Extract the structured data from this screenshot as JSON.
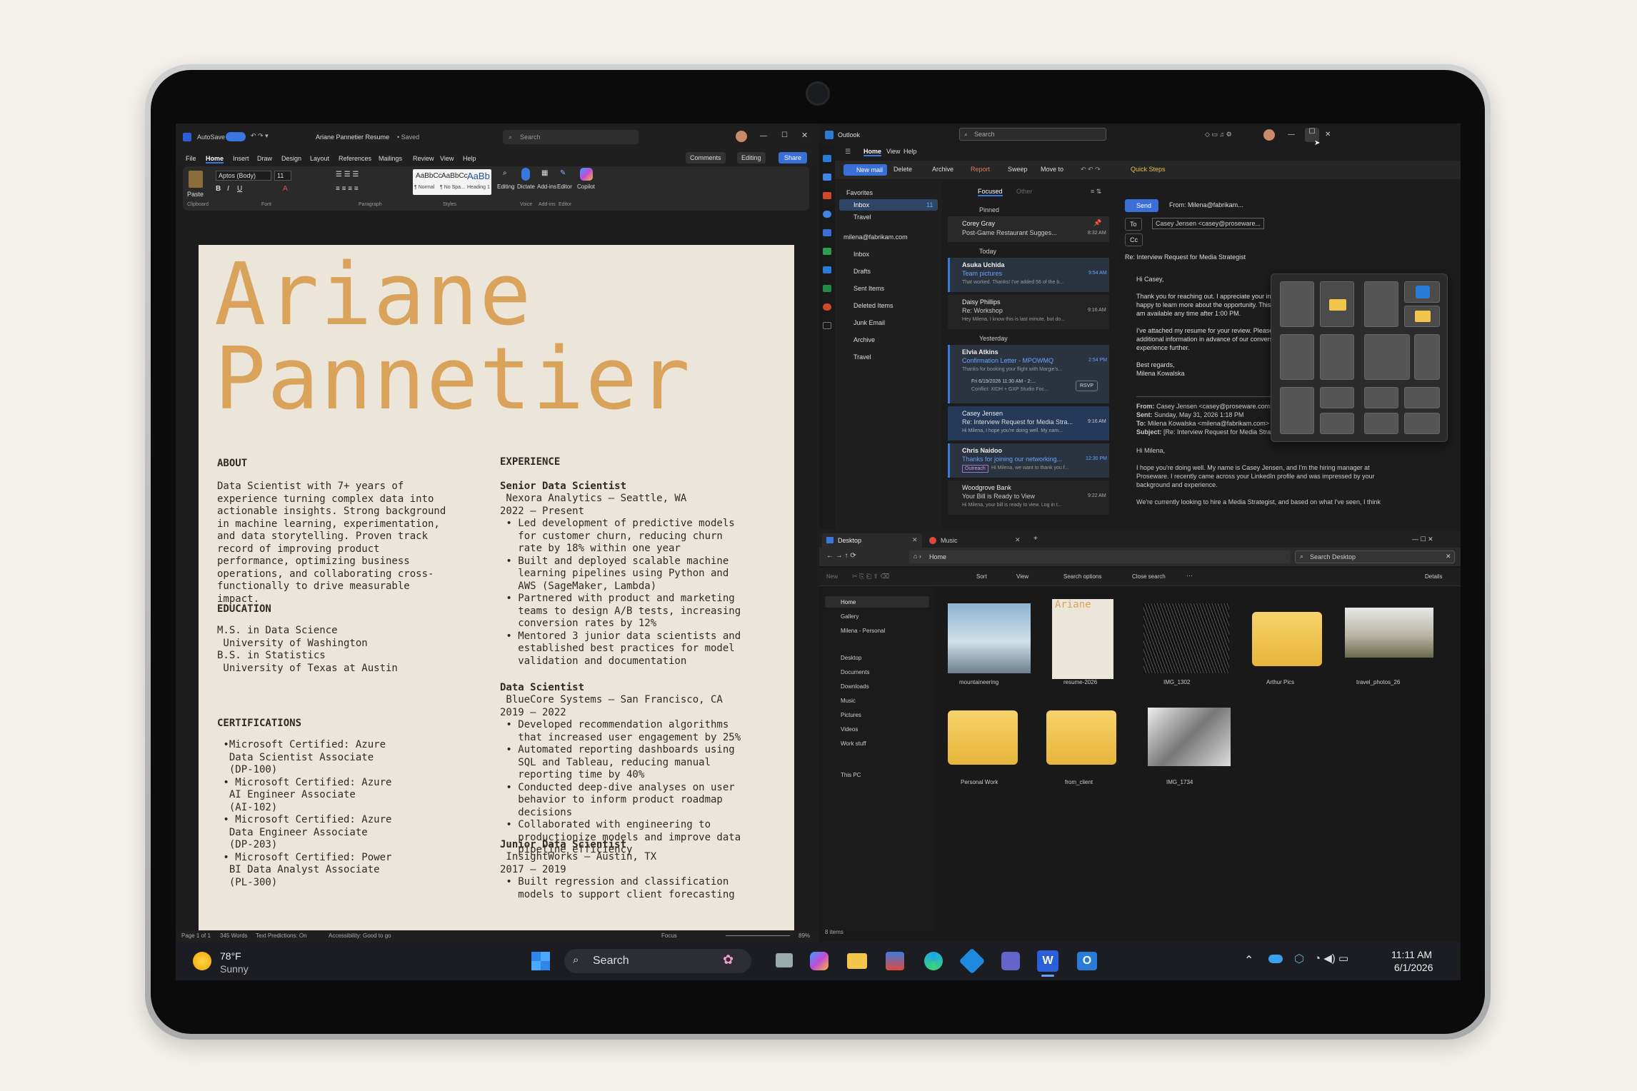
{
  "word": {
    "autosave": "AutoSave",
    "doc_title": "Ariane Pannetier Resume",
    "saved": "• Saved",
    "search": "Search",
    "tabs": [
      "File",
      "Home",
      "Insert",
      "Draw",
      "Design",
      "Layout",
      "References",
      "Mailings",
      "Review",
      "View",
      "Help"
    ],
    "comments": "Comments",
    "editing": "Editing",
    "share": "Share",
    "font": "Aptos (Body)",
    "size": "11",
    "styles": [
      {
        "sample": "AaBbCc",
        "name": "¶ Normal"
      },
      {
        "sample": "AaBbCc",
        "name": "¶ No Spa..."
      },
      {
        "sample": "AaBb",
        "name": "Heading 1"
      }
    ],
    "ribbon_groups": [
      "Clipboard",
      "Font",
      "Paragraph",
      "Styles",
      "Voice",
      "Add-ins",
      "Editor"
    ],
    "ribbon_buttons": [
      "Paste",
      "Editing",
      "Dictate",
      "Add-ins",
      "Editor",
      "Copilot"
    ],
    "status": [
      "Page 1 of 1",
      "345 Words",
      "Text Predictions: On",
      "Accessibility: Good to go",
      "Focus",
      "89%"
    ]
  },
  "resume": {
    "first": "Ariane",
    "last": "Pannetier",
    "about_h": "ABOUT",
    "about": "Data Scientist with 7+ years of\nexperience turning complex data into\nactionable insights. Strong background\nin machine learning, experimentation,\nand data storytelling. Proven track\nrecord of improving product\nperformance, optimizing business\noperations, and collaborating cross-\nfunctionally to drive measurable\nimpact.",
    "edu_h": "EDUCATION",
    "edu": "M.S. in Data Science\n University of Washington\nB.S. in Statistics\n University of Texas at Austin",
    "cert_h": "CERTIFICATIONS",
    "cert": " •Microsoft Certified: Azure\n  Data Scientist Associate\n  (DP-100)\n • Microsoft Certified: Azure\n  AI Engineer Associate\n  (AI-102)\n • Microsoft Certified: Azure\n  Data Engineer Associate\n  (DP-203)\n • Microsoft Certified: Power\n  BI Data Analyst Associate\n  (PL-300)",
    "exp_h": "EXPERIENCE",
    "jobs": [
      {
        "title": "Senior Data Scientist",
        "meta": " Nexora Analytics — Seattle, WA\n2022 – Present",
        "bullets": " • Led development of predictive models\n   for customer churn, reducing churn\n   rate by 18% within one year\n • Built and deployed scalable machine\n   learning pipelines using Python and\n   AWS (SageMaker, Lambda)\n • Partnered with product and marketing\n   teams to design A/B tests, increasing\n   conversion rates by 12%\n • Mentored 3 junior data scientists and\n   established best practices for model\n   validation and documentation"
      },
      {
        "title": "Data Scientist",
        "meta": " BlueCore Systems — San Francisco, CA\n2019 – 2022",
        "bullets": " • Developed recommendation algorithms\n   that increased user engagement by 25%\n • Automated reporting dashboards using\n   SQL and Tableau, reducing manual\n   reporting time by 40%\n • Conducted deep-dive analyses on user\n   behavior to inform product roadmap\n   decisions\n • Collaborated with engineering to\n   productionize models and improve data\n   pipeline efficiency"
      },
      {
        "title": "Junior Data Scientist",
        "meta": " InsightWorks — Austin, TX\n2017 – 2019",
        "bullets": " • Built regression and classification\n   models to support client forecasting"
      }
    ]
  },
  "outlook": {
    "app": "Outlook",
    "search": "Search",
    "tabs": [
      "Home",
      "View",
      "Help"
    ],
    "toolbar": [
      "New mail",
      "Delete",
      "Archive",
      "Report",
      "Sweep",
      "Move to",
      "Quick Steps"
    ],
    "favorites": "Favorites",
    "fav_items": [
      {
        "label": "Inbox",
        "count": "11"
      },
      {
        "label": "Travel",
        "count": ""
      }
    ],
    "account": "milena@fabrikam.com",
    "folders": [
      "Inbox",
      "Drafts",
      "Sent Items",
      "Deleted Items",
      "Junk Email",
      "Archive",
      "Travel"
    ],
    "list_tabs": [
      "Focused",
      "Other"
    ],
    "groups": [
      "Pinned",
      "Today",
      "Yesterday"
    ],
    "mails": [
      {
        "from": "Corey Gray",
        "subject": "Post-Game Restaurant Sugges...",
        "time": "8:32 AM",
        "preview": ""
      },
      {
        "from": "Asuka Uchida",
        "subject": "Team pictures",
        "time": "9:54 AM",
        "preview": "That worked. Thanks! I've added 56 of the b..."
      },
      {
        "from": "Daisy Phillips",
        "subject": "Re: Workshop",
        "time": "9:16 AM",
        "preview": "Hey Milena, I know this is last minute, but do..."
      },
      {
        "from": "Elvia Atkins",
        "subject": "Confirmation Letter - MPOWMQ",
        "time": "2:54 PM",
        "preview": "Thanks for booking your flight with Margie's...",
        "event": "Fri 6/19/2026 11:30 AM - 2:...",
        "conflict": "Conflict: XIDH + GXP Studio Foc...",
        "rsvp": "RSVP"
      },
      {
        "from": "Casey Jensen",
        "subject": "Re: Interview Request for Media Stra...",
        "time": "9:16 AM",
        "preview": "Hi Milena, I hope you're doing well. My nam..."
      },
      {
        "from": "Chris Naidoo",
        "subject": "Thanks for joining our networking...",
        "time": "12:30 PM",
        "preview": "Hi Milena, we want to thank you f...",
        "tag": "Outreach"
      },
      {
        "from": "Woodgrove Bank",
        "subject": "Your Bill is Ready to View",
        "time": "9:22 AM",
        "preview": "Hi Milena, your bill is ready to view. Log in t..."
      }
    ],
    "send": "Send",
    "from": "From: Milena@fabrikam...",
    "to_label": "To",
    "to": "Casey Jensen <casey@proseware...",
    "cc": "Cc",
    "subject": "Re: Interview Request for Media Strategist",
    "body": "Hi Casey,\n\nThank you for reaching out. I appreciate your interest in my background and would be\nhappy to learn more about the opportunity. This Wednesday works well for me, and I\nam available any time after 1:00 PM.\n\nI've attached my resume for your review. Please let me know if you need any\nadditional information in advance of our conversation, I'd be glad to discuss my\nexperience further.\n\nBest regards,\nMilena Kowalska",
    "quoted": [
      {
        "k": "From:",
        "v": " Casey Jensen <casey@proseware.com>"
      },
      {
        "k": "Sent:",
        "v": " Sunday, May 31, 2026 1:18 PM"
      },
      {
        "k": "To:",
        "v": " Milena Kowalska <milena@fabrikam.com>"
      },
      {
        "k": "Subject:",
        "v": " [Re: Interview Request for Media Strategist]"
      }
    ],
    "quoted_body": "Hi Milena,\n\nI hope you're doing well. My name is Casey Jensen, and I'm the hiring manager at\nProseware. I recently came across your LinkedIn profile and was impressed by your\nbackground and experience.\n\nWe're currently looking to hire a Media Strategist, and based on what I've seen, I think"
  },
  "explorer": {
    "tabs": [
      "Desktop",
      "Music"
    ],
    "path": "Home",
    "search": "Search Desktop",
    "toolbar": [
      "New",
      "Sort",
      "View",
      "Search options",
      "Close search",
      "Details"
    ],
    "nav_top": [
      "Home",
      "Gallery",
      "Milena - Personal"
    ],
    "nav": [
      "Desktop",
      "Documents",
      "Downloads",
      "Music",
      "Pictures",
      "Videos",
      "Work stuff"
    ],
    "this_pc": "This PC",
    "items": [
      "mountaineering",
      "resume-2026",
      "IMG_1302",
      "Arthur Pics",
      "travel_photos_26",
      "Personal Work",
      "from_client",
      "IMG_1734"
    ],
    "count": "8 items"
  },
  "taskbar": {
    "temp": "78°F",
    "cond": "Sunny",
    "search": "Search",
    "time": "11:11 AM",
    "date": "6/1/2026"
  }
}
